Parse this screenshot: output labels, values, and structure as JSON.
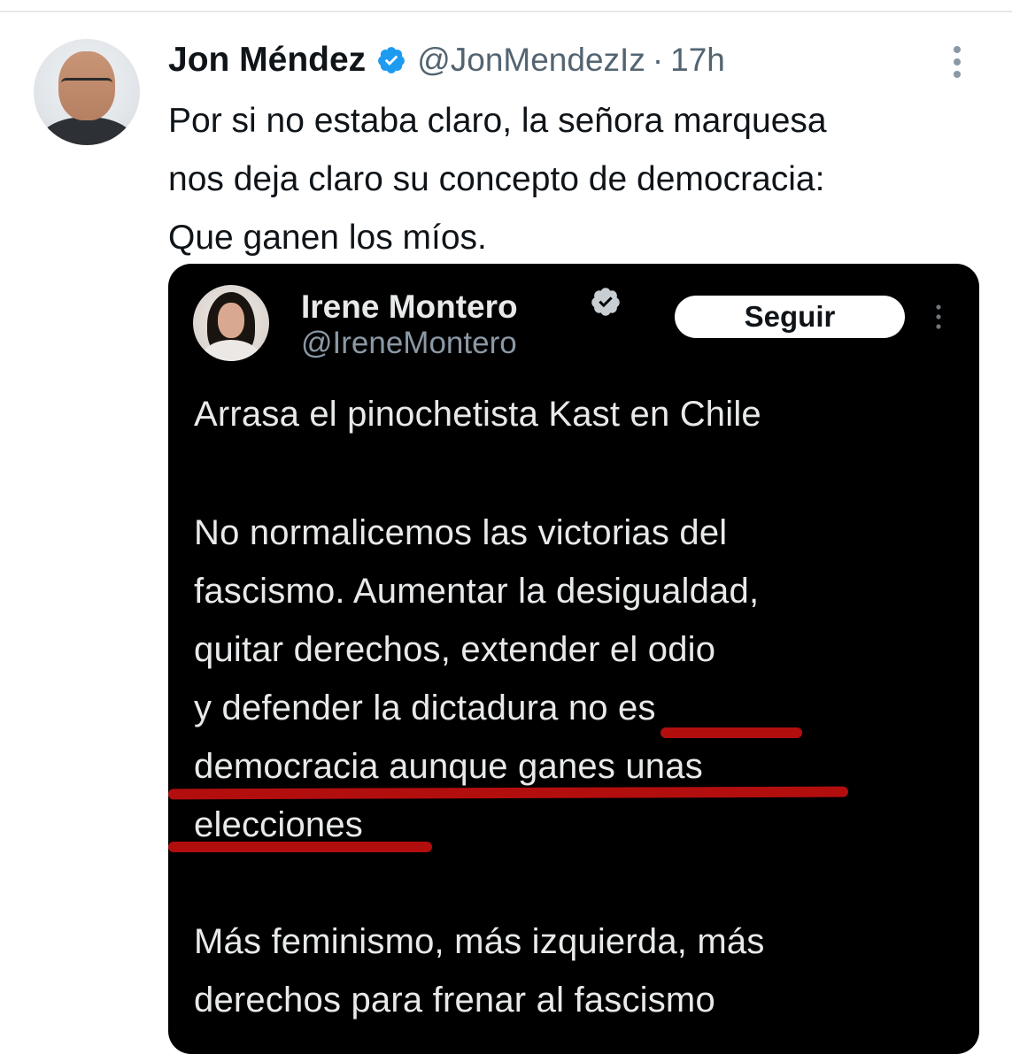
{
  "tweet": {
    "author_name": "Jon Méndez",
    "handle": "@JonMendezIz",
    "separator": "·",
    "time": "17h",
    "text": "Por si no estaba claro, la señora marquesa\nnos deja claro su concepto de democracia:\nQue ganen los míos."
  },
  "embedded_tweet": {
    "author_name": "Irene Montero",
    "handle": "@IreneMontero",
    "follow_label": "Seguir",
    "lines": [
      "Arrasa el pinochetista Kast en Chile",
      "No normalicemos las victorias del",
      "fascismo. Aumentar la desigualdad,",
      "quitar derechos, extender el odio",
      "y defender la dictadura no es",
      "democracia aunque ganes unas",
      "elecciones",
      "Más feminismo, más izquierda, más",
      "derechos para frenar al fascismo"
    ]
  },
  "colors": {
    "verified_blue": "#1d9bf0",
    "highlight_red": "#b30e0e",
    "embed_background": "#000000",
    "secondary_text": "#536471"
  },
  "icons": [
    "verified-badge-icon",
    "more-options-icon",
    "avatar"
  ]
}
